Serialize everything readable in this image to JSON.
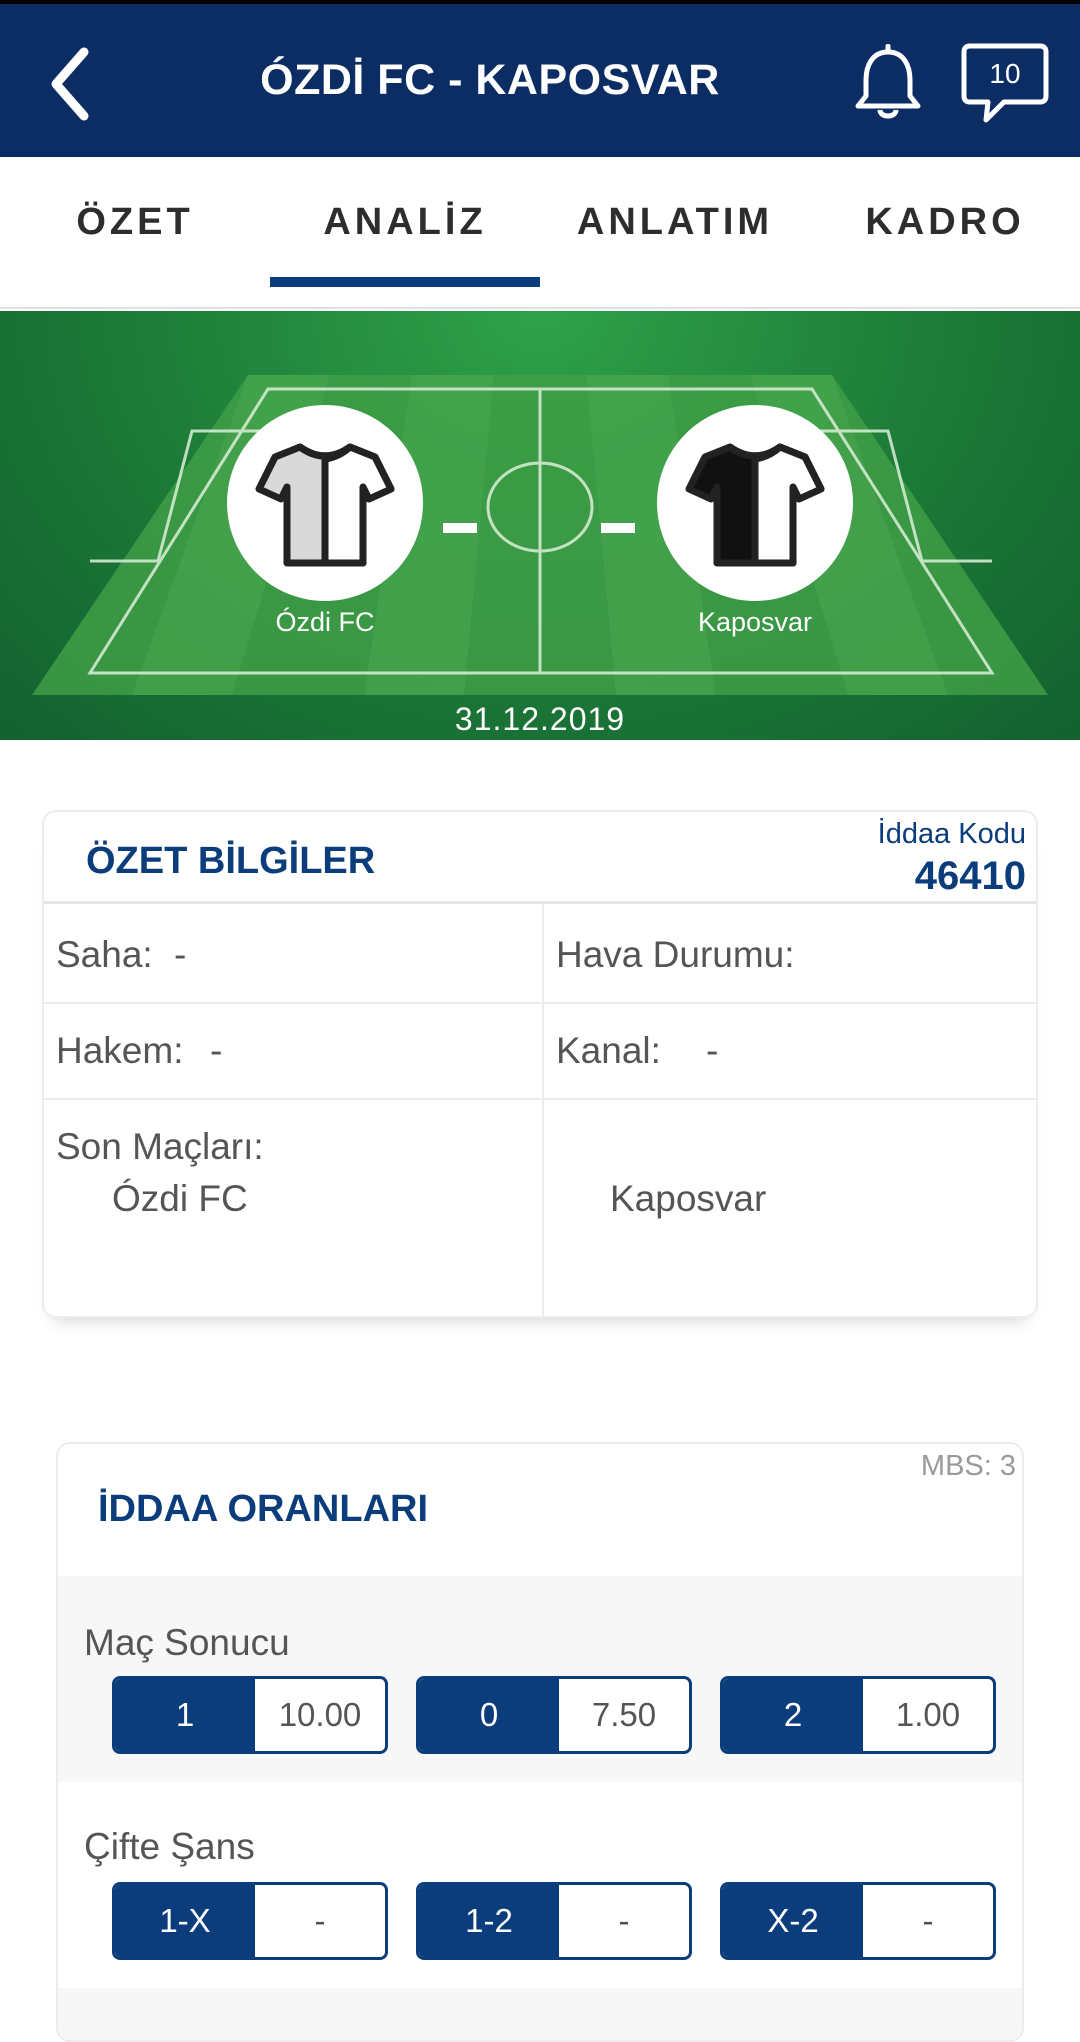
{
  "header": {
    "title": "ÓZDİ FC - KAPOSVAR",
    "notification_count": "10",
    "colors": {
      "primary": "#0b2d63",
      "accent": "#0b3d7c"
    }
  },
  "tabs": [
    {
      "label": "ÖZET",
      "active": false
    },
    {
      "label": "ANALİZ",
      "active": true
    },
    {
      "label": "ANLATIM",
      "active": false
    },
    {
      "label": "KADRO",
      "active": false
    }
  ],
  "match": {
    "home": {
      "name": "Ózdi FC",
      "kit_icon": "white-grey-shirt-icon"
    },
    "away": {
      "name": "Kaposvar",
      "kit_icon": "black-white-shirt-icon"
    },
    "date": "31.12.2019"
  },
  "summary": {
    "title": "ÖZET BİLGİLER",
    "iddaa_code_label": "İddaa Kodu",
    "iddaa_code": "46410",
    "field_label": "Saha:",
    "field_value": "-",
    "weather_label": "Hava Durumu:",
    "referee_label": "Hakem:",
    "referee_value": "-",
    "channel_label": "Kanal:",
    "channel_value": "-",
    "last_matches_label": "Son Maçları:",
    "last_matches_home": "Ózdi FC",
    "last_matches_away": "Kaposvar"
  },
  "odds": {
    "title": "İDDAA ORANLARI",
    "mbs": "MBS: 3",
    "markets": [
      {
        "name": "Maç Sonucu",
        "options": [
          {
            "key": "1",
            "value": "10.00"
          },
          {
            "key": "0",
            "value": "7.50"
          },
          {
            "key": "2",
            "value": "1.00"
          }
        ]
      },
      {
        "name": "Çifte Şans",
        "options": [
          {
            "key": "1-X",
            "value": "-"
          },
          {
            "key": "1-2",
            "value": "-"
          },
          {
            "key": "X-2",
            "value": "-"
          }
        ]
      }
    ]
  }
}
